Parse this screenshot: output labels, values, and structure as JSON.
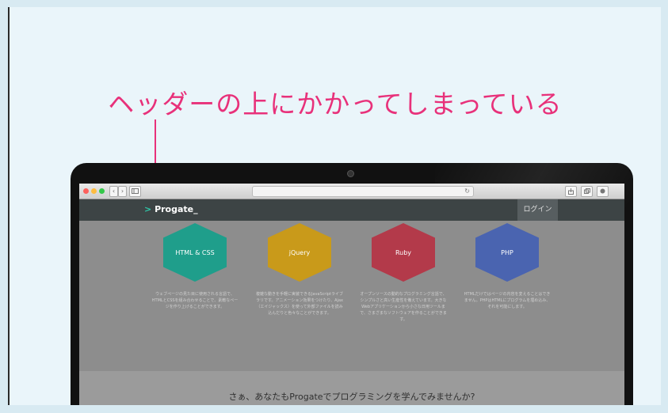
{
  "annotation": {
    "text": "ヘッダーの上にかかってしまっている"
  },
  "browser": {
    "nav_back": "‹",
    "nav_forward": "›",
    "sidebar_icon": "sidebar-icon",
    "reload_icon": "↻",
    "share_icon": "share-icon",
    "tabs_icon": "tabs-icon",
    "download_icon": "download-icon"
  },
  "site": {
    "logo_prefix": ">",
    "logo_name": "Progate",
    "logo_cursor": "_",
    "login_label": "ログイン",
    "languages": [
      {
        "name": "HTML & CSS",
        "color": "#1f9e8b",
        "desc": "ウェブページの見た目に使用される言語で、HTMLとCSSを組み合わせることで、素敵なページを作り上げることができます。"
      },
      {
        "name": "jQuery",
        "color": "#c99a1a",
        "desc": "複雑な動きを手軽に実装できるJavaScriptライブラリです。アニメーション効果をつけたり、Ajax（エイジャックス）を使って外部ファイルを読み込んだりと色々なことができます。"
      },
      {
        "name": "Ruby",
        "color": "#b33a4a",
        "desc": "オープンソースの動的なプログラミング言語で、シンプルさと高い生産性を備えています。大きなWebアプリケーションから小さな日用ツールまで、さまざまなソフトウェアを作ることができます。"
      },
      {
        "name": "PHP",
        "color": "#4a64b0",
        "desc": "HTMLだけではページの内容を変えることはできません。PHPはHTMLにプログラムを埋め込み、それを可能にします。"
      }
    ],
    "cta_text": "さぁ、あなたもProgateでプログラミングを学んでみませんか?"
  }
}
